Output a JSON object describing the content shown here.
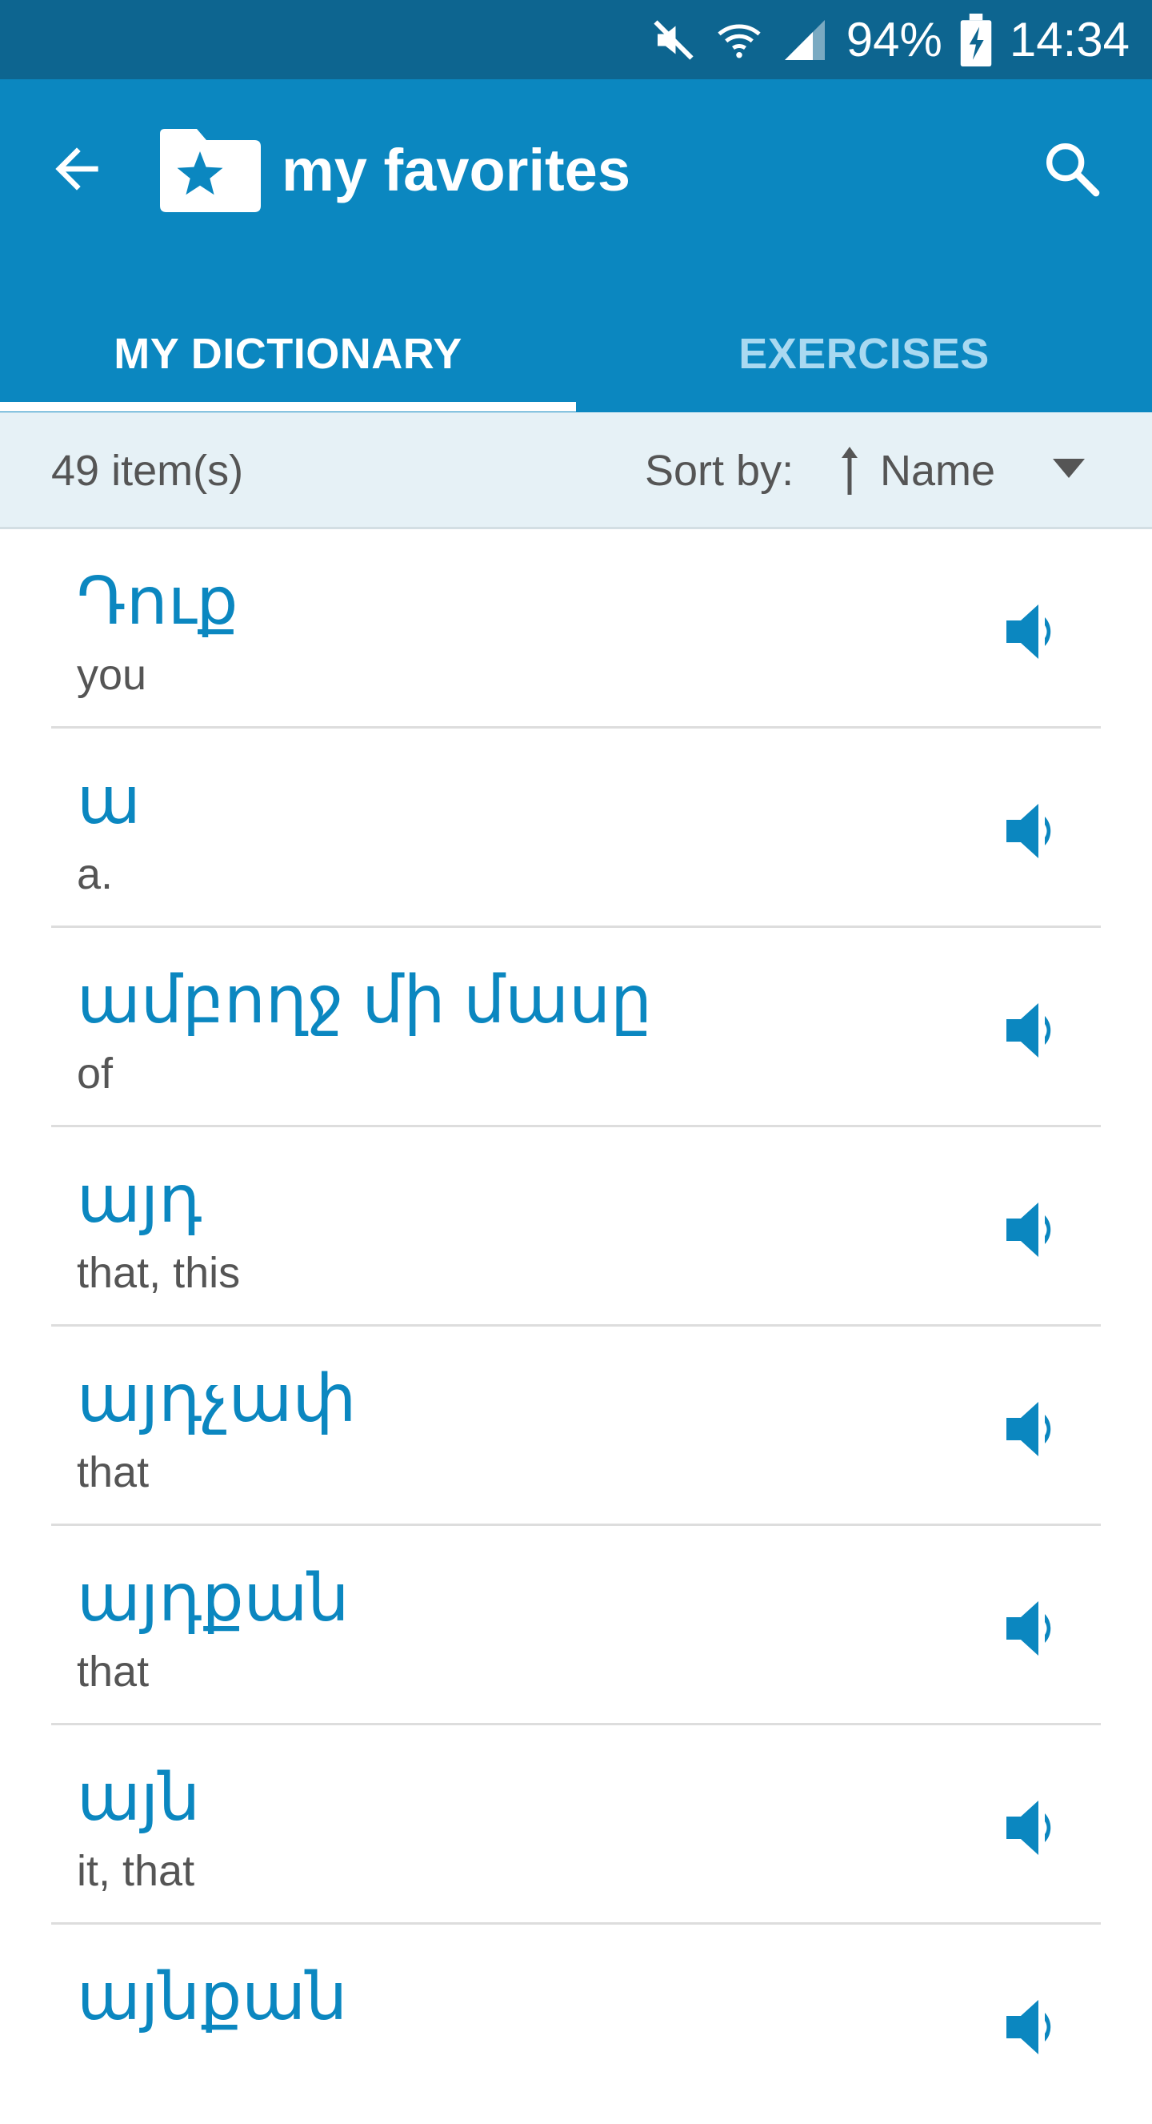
{
  "colors": {
    "status_bar": "#0d6590",
    "app_bar": "#0b87c0",
    "tab_inactive": "#a9d9f1",
    "word_text": "#0b87c0",
    "sort_bar_bg": "#e6f1f6"
  },
  "status_bar": {
    "icons": [
      "mute-icon",
      "wifi-icon",
      "signal-icon"
    ],
    "battery": "94%",
    "battery_icon": "battery-charging-icon",
    "time": "14:34"
  },
  "header": {
    "back_icon": "back-arrow-icon",
    "folder_icon": "folder-star-icon",
    "title": "my favorites",
    "search_icon": "search-icon"
  },
  "tabs": [
    {
      "label": "MY DICTIONARY",
      "active": true
    },
    {
      "label": "EXERCISES",
      "active": false
    }
  ],
  "sort_bar": {
    "count": "49 item(s)",
    "sort_label": "Sort by:",
    "sort_direction_icon": "sort-ascending-arrow-icon",
    "sort_value": "Name",
    "dropdown_icon": "dropdown-triangle-icon"
  },
  "items": [
    {
      "word": "Դուք",
      "translation": "you"
    },
    {
      "word": "ա",
      "translation": "a."
    },
    {
      "word": "ամբողջ մի մասը",
      "translation": "of"
    },
    {
      "word": "այդ",
      "translation": "that, this"
    },
    {
      "word": "այդչափ",
      "translation": "that"
    },
    {
      "word": "այդքան",
      "translation": "that"
    },
    {
      "word": "այն",
      "translation": "it, that"
    },
    {
      "word": "այնքան",
      "translation": ""
    }
  ],
  "item_icon": "speaker-icon"
}
